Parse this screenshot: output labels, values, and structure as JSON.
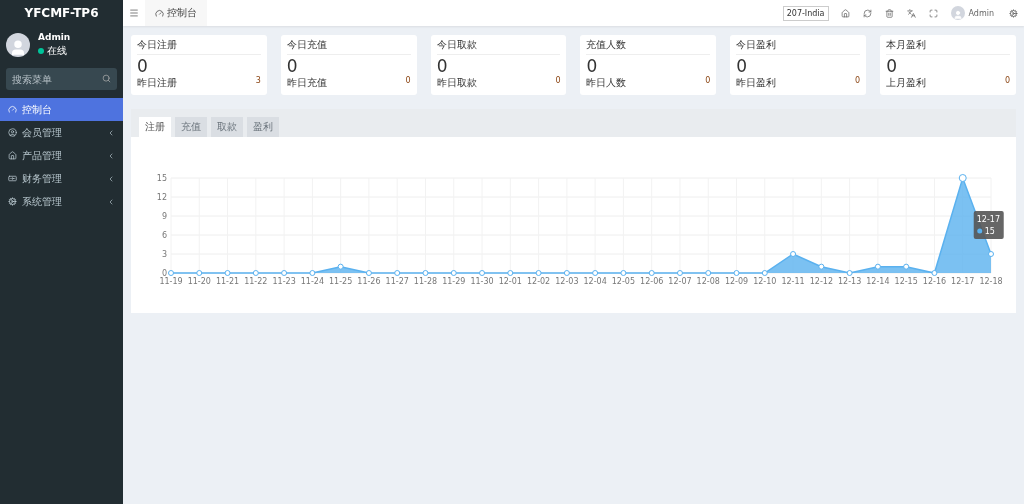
{
  "sidebar": {
    "logo": "YFCMF-TP6",
    "user": {
      "name": "Admin",
      "status": "在线",
      "online": true
    },
    "search": {
      "placeholder": "搜索菜单"
    },
    "items": [
      {
        "label": "控制台",
        "selected": true,
        "has_children": false
      },
      {
        "label": "会员管理",
        "selected": false,
        "has_children": true
      },
      {
        "label": "产品管理",
        "selected": false,
        "has_children": true
      },
      {
        "label": "财务管理",
        "selected": false,
        "has_children": true
      },
      {
        "label": "系统管理",
        "selected": false,
        "has_children": true
      }
    ]
  },
  "header": {
    "tab": "控制台",
    "badge": "207-India",
    "user": "Admin"
  },
  "cards": [
    {
      "title": "今日注册",
      "value": "0",
      "footer_label": "昨日注册",
      "footer_value": "3"
    },
    {
      "title": "今日充值",
      "value": "0",
      "footer_label": "昨日充值",
      "footer_value": "0"
    },
    {
      "title": "今日取款",
      "value": "0",
      "footer_label": "昨日取款",
      "footer_value": "0"
    },
    {
      "title": "充值人数",
      "value": "0",
      "footer_label": "昨日人数",
      "footer_value": "0"
    },
    {
      "title": "今日盈利",
      "value": "0",
      "footer_label": "昨日盈利",
      "footer_value": "0"
    },
    {
      "title": "本月盈利",
      "value": "0",
      "footer_label": "上月盈利",
      "footer_value": "0"
    }
  ],
  "chart_tabs": [
    {
      "label": "注册",
      "selected": true
    },
    {
      "label": "充值",
      "selected": false
    },
    {
      "label": "取款",
      "selected": false
    },
    {
      "label": "盈利",
      "selected": false
    }
  ],
  "chart": {
    "chart_data": {
      "type": "area",
      "grid": true,
      "categories": [
        "11-19",
        "11-20",
        "11-21",
        "11-22",
        "11-23",
        "11-24",
        "11-25",
        "11-26",
        "11-27",
        "11-28",
        "11-29",
        "11-30",
        "12-01",
        "12-02",
        "12-03",
        "12-04",
        "12-05",
        "12-06",
        "12-07",
        "12-08",
        "12-09",
        "12-10",
        "12-11",
        "12-12",
        "12-13",
        "12-14",
        "12-15",
        "12-16",
        "12-17",
        "12-18"
      ],
      "series": [
        {
          "color": "#5ab1ef",
          "values": [
            0,
            0,
            0,
            0,
            0,
            0,
            1,
            0,
            0,
            0,
            0,
            0,
            0,
            0,
            0,
            0,
            0,
            0,
            0,
            0,
            0,
            0,
            3,
            1,
            0,
            1,
            1,
            0,
            15,
            3
          ]
        }
      ],
      "ylim": [
        0,
        15
      ],
      "yticks": [
        0,
        3,
        6,
        9,
        12,
        15
      ]
    },
    "tooltip": {
      "title": "12-17",
      "value": "15"
    }
  }
}
